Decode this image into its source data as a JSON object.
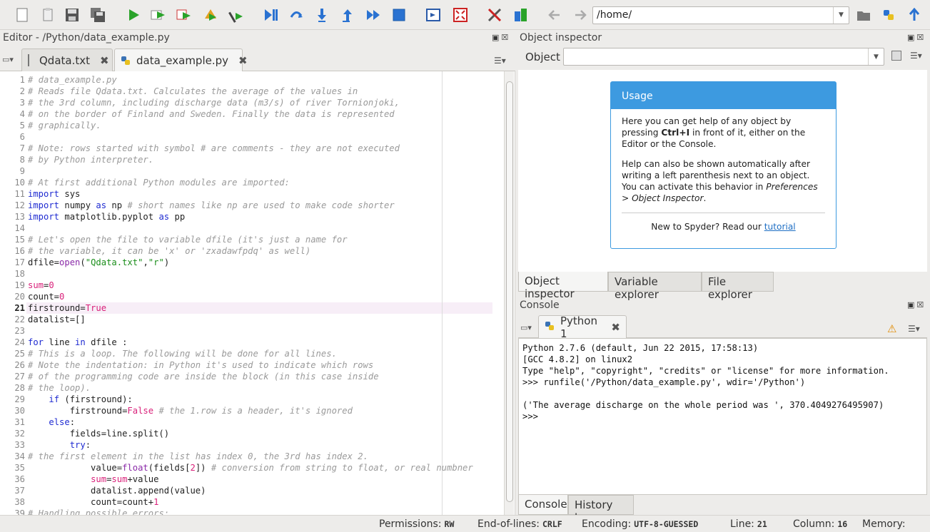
{
  "toolbar": {
    "buttons": [
      "new-file",
      "open-file",
      "save-file",
      "save-all",
      "run",
      "run-cell",
      "run-cell-advance",
      "run-selection",
      "run-config",
      "debug",
      "step",
      "step-into",
      "step-return",
      "continue",
      "stop",
      "maximize-pane",
      "fullscreen",
      "tools",
      "python-path-manager"
    ],
    "path_value": "/home/"
  },
  "editor": {
    "title": "Editor - /Python/data_example.py",
    "tabs": [
      {
        "label": "Qdata.txt",
        "active": false
      },
      {
        "label": "data_example.py",
        "active": true
      }
    ],
    "lines": [
      {
        "n": "1",
        "parts": [
          [
            "cm",
            "# data_example.py"
          ]
        ]
      },
      {
        "n": "2",
        "parts": [
          [
            "cm",
            "# Reads file Qdata.txt. Calculates the average of the values in"
          ]
        ]
      },
      {
        "n": "3",
        "parts": [
          [
            "cm",
            "# the 3rd column, including discharge data (m3/s) of river Tornionjoki,"
          ]
        ]
      },
      {
        "n": "4",
        "parts": [
          [
            "cm",
            "# on the border of Finland and Sweden. Finally the data is represented"
          ]
        ]
      },
      {
        "n": "5",
        "parts": [
          [
            "cm",
            "# graphically."
          ]
        ]
      },
      {
        "n": "6",
        "parts": []
      },
      {
        "n": "7",
        "parts": [
          [
            "cm",
            "# Note: rows started with symbol # are comments - they are not executed"
          ]
        ]
      },
      {
        "n": "8",
        "parts": [
          [
            "cm",
            "# by Python interpreter."
          ]
        ]
      },
      {
        "n": "9",
        "parts": []
      },
      {
        "n": "10",
        "parts": [
          [
            "cm",
            "# At first additional Python modules are imported:"
          ]
        ]
      },
      {
        "n": "11",
        "parts": [
          [
            "kw",
            "import"
          ],
          [
            "",
            " sys"
          ]
        ]
      },
      {
        "n": "12",
        "parts": [
          [
            "kw",
            "import"
          ],
          [
            "",
            " numpy "
          ],
          [
            "kw",
            "as"
          ],
          [
            "",
            " np "
          ],
          [
            "cm",
            "# short names like np are used to make code shorter"
          ]
        ]
      },
      {
        "n": "13",
        "parts": [
          [
            "kw",
            "import"
          ],
          [
            "",
            " matplotlib.pyplot "
          ],
          [
            "kw",
            "as"
          ],
          [
            "",
            " pp"
          ]
        ]
      },
      {
        "n": "14",
        "parts": []
      },
      {
        "n": "15",
        "parts": [
          [
            "cm",
            "# Let's open the file to variable dfile (it's just a name for"
          ]
        ]
      },
      {
        "n": "16",
        "parts": [
          [
            "cm",
            "# the variable, it can be 'x' or 'zxadawfpdq' as well)"
          ]
        ]
      },
      {
        "n": "17",
        "parts": [
          [
            "",
            "dfile="
          ],
          [
            "bi",
            "open"
          ],
          [
            "",
            "("
          ],
          [
            "st",
            "\"Qdata.txt\""
          ],
          [
            "",
            ","
          ],
          [
            "st",
            "\"r\""
          ],
          [
            "",
            ")"
          ]
        ]
      },
      {
        "n": "18",
        "parts": []
      },
      {
        "n": "19",
        "parts": [
          [
            "nm",
            "sum"
          ],
          [
            "",
            "="
          ],
          [
            "nm",
            "0"
          ]
        ]
      },
      {
        "n": "20",
        "parts": [
          [
            "",
            "count="
          ],
          [
            "nm",
            "0"
          ]
        ]
      },
      {
        "n": "21",
        "parts": [
          [
            "",
            "firstround="
          ],
          [
            "nm",
            "True"
          ]
        ]
      },
      {
        "n": "22",
        "parts": [
          [
            "",
            "datalist=[]"
          ]
        ]
      },
      {
        "n": "23",
        "parts": []
      },
      {
        "n": "24",
        "parts": [
          [
            "kw",
            "for"
          ],
          [
            "",
            " line "
          ],
          [
            "kw",
            "in"
          ],
          [
            "",
            " dfile :"
          ]
        ]
      },
      {
        "n": "25",
        "parts": [
          [
            "cm",
            "# This is a loop. The following will be done for all lines."
          ]
        ]
      },
      {
        "n": "26",
        "parts": [
          [
            "cm",
            "# Note the indentation: in Python it's used to indicate which rows"
          ]
        ]
      },
      {
        "n": "27",
        "parts": [
          [
            "cm",
            "# of the programming code are inside the block (in this case inside"
          ]
        ]
      },
      {
        "n": "28",
        "parts": [
          [
            "cm",
            "# the loop)."
          ]
        ]
      },
      {
        "n": "29",
        "parts": [
          [
            "",
            "    "
          ],
          [
            "kw",
            "if"
          ],
          [
            "",
            " (firstround):"
          ]
        ]
      },
      {
        "n": "30",
        "parts": [
          [
            "",
            "        firstround="
          ],
          [
            "nm",
            "False"
          ],
          [
            "",
            " "
          ],
          [
            "cm",
            "# the 1.row is a header, it's ignored"
          ]
        ]
      },
      {
        "n": "31",
        "parts": [
          [
            "",
            "    "
          ],
          [
            "kw",
            "else"
          ],
          [
            "",
            ":"
          ]
        ]
      },
      {
        "n": "32",
        "parts": [
          [
            "",
            "        fields=line.split()"
          ]
        ]
      },
      {
        "n": "33",
        "parts": [
          [
            "",
            "        "
          ],
          [
            "kw",
            "try"
          ],
          [
            "",
            ":"
          ]
        ]
      },
      {
        "n": "34",
        "parts": [
          [
            "cm",
            "# the first element in the list has index 0, the 3rd has index 2."
          ]
        ]
      },
      {
        "n": "35",
        "parts": [
          [
            "",
            "            value="
          ],
          [
            "bi",
            "float"
          ],
          [
            "",
            "(fields["
          ],
          [
            "nm",
            "2"
          ],
          [
            "",
            "]) "
          ],
          [
            "cm",
            "# conversion from string to float, or real numbner"
          ]
        ]
      },
      {
        "n": "36",
        "parts": [
          [
            "",
            "            "
          ],
          [
            "nm",
            "sum"
          ],
          [
            "",
            "="
          ],
          [
            "nm",
            "sum"
          ],
          [
            "",
            "+value"
          ]
        ]
      },
      {
        "n": "37",
        "parts": [
          [
            "",
            "            datalist.append(value)"
          ]
        ]
      },
      {
        "n": "38",
        "parts": [
          [
            "",
            "            count=count+"
          ],
          [
            "nm",
            "1"
          ]
        ]
      },
      {
        "n": "39",
        "parts": [
          [
            "cm",
            "# Handling possible errors:"
          ]
        ]
      }
    ],
    "current_line": "21"
  },
  "inspector": {
    "title": "Object inspector",
    "object_label": "Object",
    "object_value": "",
    "usage_title": "Usage",
    "para1_a": "Here you can get help of any object by pressing ",
    "para1_b": "Ctrl+I",
    "para1_c": " in front of it, either on the Editor or the Console.",
    "para2_a": "Help can also be shown automatically after writing a left parenthesis next to an object. You can activate this behavior in ",
    "para2_b": "Preferences > Object Inspector",
    "para2_c": ".",
    "foot_text": "New to Spyder? Read our ",
    "foot_link": "tutorial",
    "bottom_tabs": [
      "Object inspector",
      "Variable explorer",
      "File explorer"
    ]
  },
  "console": {
    "title": "Console",
    "tab_label": "Python 1",
    "lines": [
      "Python 2.7.6 (default, Jun 22 2015, 17:58:13)",
      "[GCC 4.8.2] on linux2",
      "Type \"help\", \"copyright\", \"credits\" or \"license\" for more information.",
      ">>> runfile('/Python/data_example.py', wdir='/Python')",
      "",
      "('The average discharge on the whole period was ', 370.4049276495907)",
      ">>> "
    ],
    "bottom_tabs": [
      "Console",
      "History log"
    ]
  },
  "status": {
    "permissions_label": "Permissions:",
    "permissions": "RW",
    "eol_label": "End-of-lines:",
    "eol": "CRLF",
    "encoding_label": "Encoding:",
    "encoding": "UTF-8-GUESSED",
    "line_label": "Line:",
    "line": "21",
    "column_label": "Column:",
    "column": "16",
    "memory_label": "Memory:"
  }
}
